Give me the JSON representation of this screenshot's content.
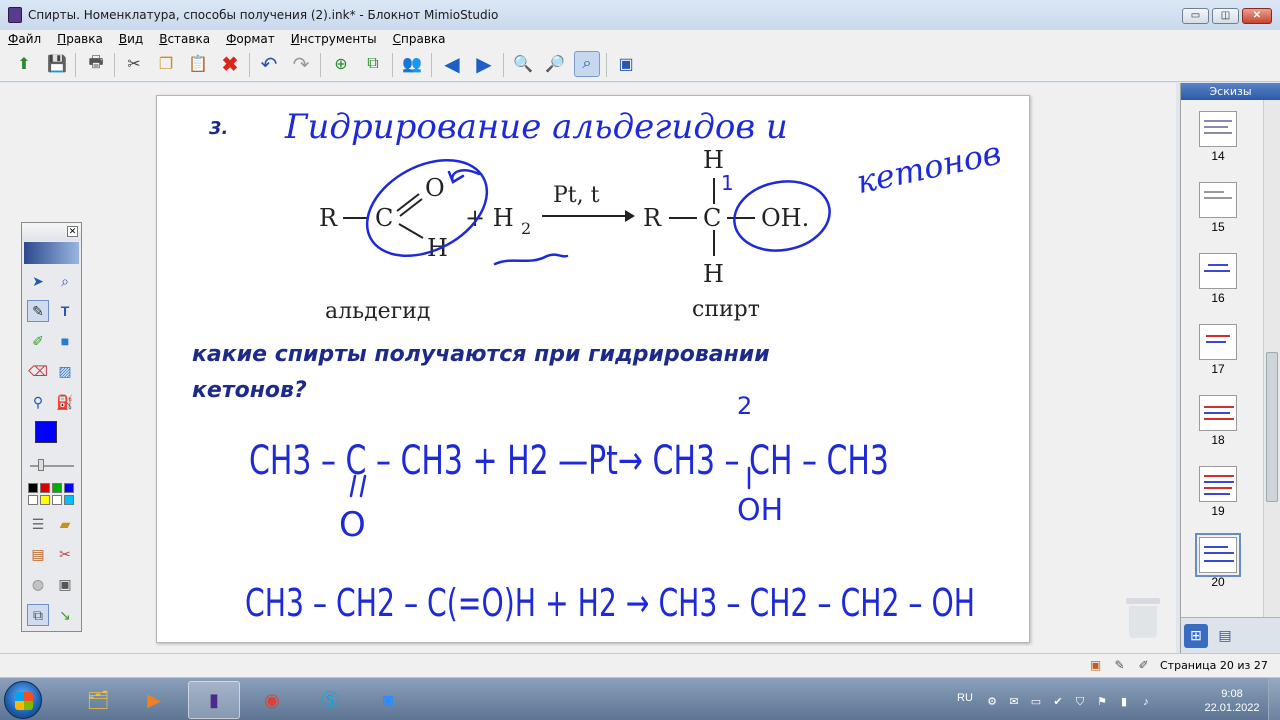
{
  "window": {
    "title": "Спирты. Номенклатура, способы получения (2).ink* - Блокнот MimioStudio",
    "minimize": "▭",
    "maximize": "◫",
    "close": "✕"
  },
  "menu": [
    "Файл",
    "Правка",
    "Вид",
    "Вставка",
    "Формат",
    "Инструменты",
    "Справка"
  ],
  "toolbar_icons": [
    "open-icon",
    "save-icon",
    "print-icon",
    "cut-icon",
    "copy-icon",
    "paste-icon",
    "delete-icon",
    "undo-icon",
    "redo-icon",
    "new-page-icon",
    "duplicate-page-icon",
    "users-icon",
    "back-icon",
    "forward-icon",
    "zoom-in-icon",
    "zoom-out-icon",
    "zoom-fit-icon",
    "screen-icon"
  ],
  "page": {
    "step_number": "3.",
    "handwritten_title_line1": "Гидрирование альдегидов и",
    "handwritten_title_line2": "кетонов",
    "reaction": {
      "r_left": "R",
      "carbonyl_c": "C",
      "oxygen": "O",
      "hydrogen_low": "H",
      "plus_h2": "+ H",
      "h2_sub": "2",
      "catalyst": "Pt, t",
      "r_right": "R",
      "alcohol_c": "C",
      "h_top": "H",
      "h_bottom": "H",
      "oh": "OH.",
      "label_left": "альдегид",
      "label_right": "спирт",
      "mark_1": "1"
    },
    "question_line1": "какие спирты получаются при гидрировании",
    "question_line2": "кетонов?",
    "eq1": "CH3 – C – CH3 + H2 —Pt→ CH3 – CH – CH3",
    "eq1_mark": "2",
    "eq1_o": "O",
    "eq1_oh": "OH",
    "eq2": "CH3 – CH2 – C(=O)H + H2 → CH3 – CH2 – CH2 – OH"
  },
  "thumbnails": {
    "title": "Эскизы",
    "pages": [
      "14",
      "15",
      "16",
      "17",
      "18",
      "19",
      "20"
    ],
    "selected": "20"
  },
  "status": {
    "page_indicator": "Страница 20 из 27"
  },
  "taskbar": {
    "apps": [
      "explorer-icon",
      "media-player-icon",
      "mimio-icon",
      "chrome-icon",
      "skype-icon",
      "zoom-icon"
    ],
    "language": "RU",
    "time": "9:08",
    "date": "22.01.2022"
  },
  "colors": {
    "ink_blue": "#1e2ad6",
    "print_blue": "#1e2a8a",
    "selected_color": "#0000ff"
  }
}
